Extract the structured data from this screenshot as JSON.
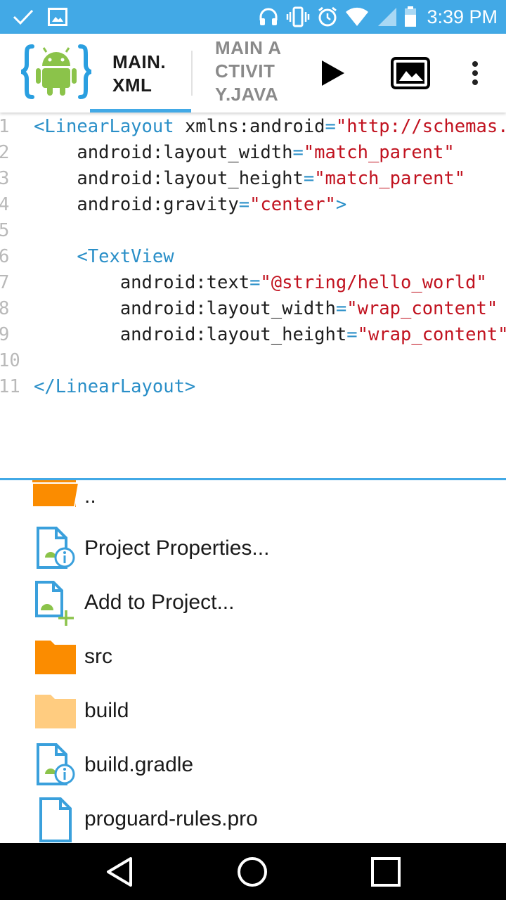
{
  "status_bar": {
    "time": "3:39 PM",
    "left_icons": [
      "check-icon",
      "image-icon"
    ],
    "right_icons": [
      "headset-icon",
      "vibrate-icon",
      "alarm-icon",
      "wifi-icon",
      "signal-icon",
      "battery-icon"
    ]
  },
  "toolbar": {
    "tabs": [
      {
        "label": "MAIN.\nXML",
        "selected": true
      },
      {
        "label": "MAIN ACTIVITY.JAVA",
        "selected": false
      }
    ],
    "actions": [
      "run-icon",
      "image-preview-icon",
      "more-vert-icon"
    ]
  },
  "editor": {
    "lines": [
      {
        "num": "1",
        "indent": "",
        "tokens": [
          [
            "tag",
            "<LinearLayout"
          ],
          [
            "attr",
            " xmlns:android"
          ],
          [
            "eq",
            "="
          ],
          [
            "val",
            "\"http://schemas.android.com/apk/res/android\""
          ]
        ]
      },
      {
        "num": "2",
        "indent": "    ",
        "tokens": [
          [
            "attr",
            "android:layout_width"
          ],
          [
            "eq",
            "="
          ],
          [
            "val",
            "\"match_parent\""
          ]
        ]
      },
      {
        "num": "3",
        "indent": "    ",
        "tokens": [
          [
            "attr",
            "android:layout_height"
          ],
          [
            "eq",
            "="
          ],
          [
            "val",
            "\"match_parent\""
          ]
        ]
      },
      {
        "num": "4",
        "indent": "    ",
        "tokens": [
          [
            "attr",
            "android:gravity"
          ],
          [
            "eq",
            "="
          ],
          [
            "val",
            "\"center\""
          ],
          [
            "tag",
            ">"
          ]
        ]
      },
      {
        "num": "5",
        "indent": "",
        "tokens": []
      },
      {
        "num": "6",
        "indent": "    ",
        "tokens": [
          [
            "tag",
            "<TextView"
          ]
        ]
      },
      {
        "num": "7",
        "indent": "        ",
        "tokens": [
          [
            "attr",
            "android:text"
          ],
          [
            "eq",
            "="
          ],
          [
            "val",
            "\"@string/hello_world\""
          ]
        ]
      },
      {
        "num": "8",
        "indent": "        ",
        "tokens": [
          [
            "attr",
            "android:layout_width"
          ],
          [
            "eq",
            "="
          ],
          [
            "val",
            "\"wrap_content\""
          ]
        ]
      },
      {
        "num": "9",
        "indent": "        ",
        "tokens": [
          [
            "attr",
            "android:layout_height"
          ],
          [
            "eq",
            "="
          ],
          [
            "val",
            "\"wrap_content\""
          ]
        ]
      },
      {
        "num": "10",
        "indent": "",
        "tokens": []
      },
      {
        "num": "11",
        "indent": "",
        "tokens": [
          [
            "tag",
            "</LinearLayout>"
          ]
        ]
      }
    ]
  },
  "files": [
    {
      "label": "..",
      "icon": "folder-up-icon"
    },
    {
      "label": "Project Properties...",
      "icon": "project-properties-icon"
    },
    {
      "label": "Add to Project...",
      "icon": "add-to-project-icon"
    },
    {
      "label": "src",
      "icon": "folder-icon"
    },
    {
      "label": "build",
      "icon": "folder-light-icon"
    },
    {
      "label": "build.gradle",
      "icon": "gradle-file-icon"
    },
    {
      "label": "proguard-rules.pro",
      "icon": "file-icon"
    }
  ],
  "nav_bar": [
    "back-icon",
    "home-icon",
    "recents-icon"
  ],
  "colors": {
    "accent": "#42a9e6",
    "tag": "#2a8fc8",
    "value": "#c1121f",
    "folder": "#fb8c00",
    "folder_light": "#ffcc80",
    "android_green": "#8bc34a"
  }
}
